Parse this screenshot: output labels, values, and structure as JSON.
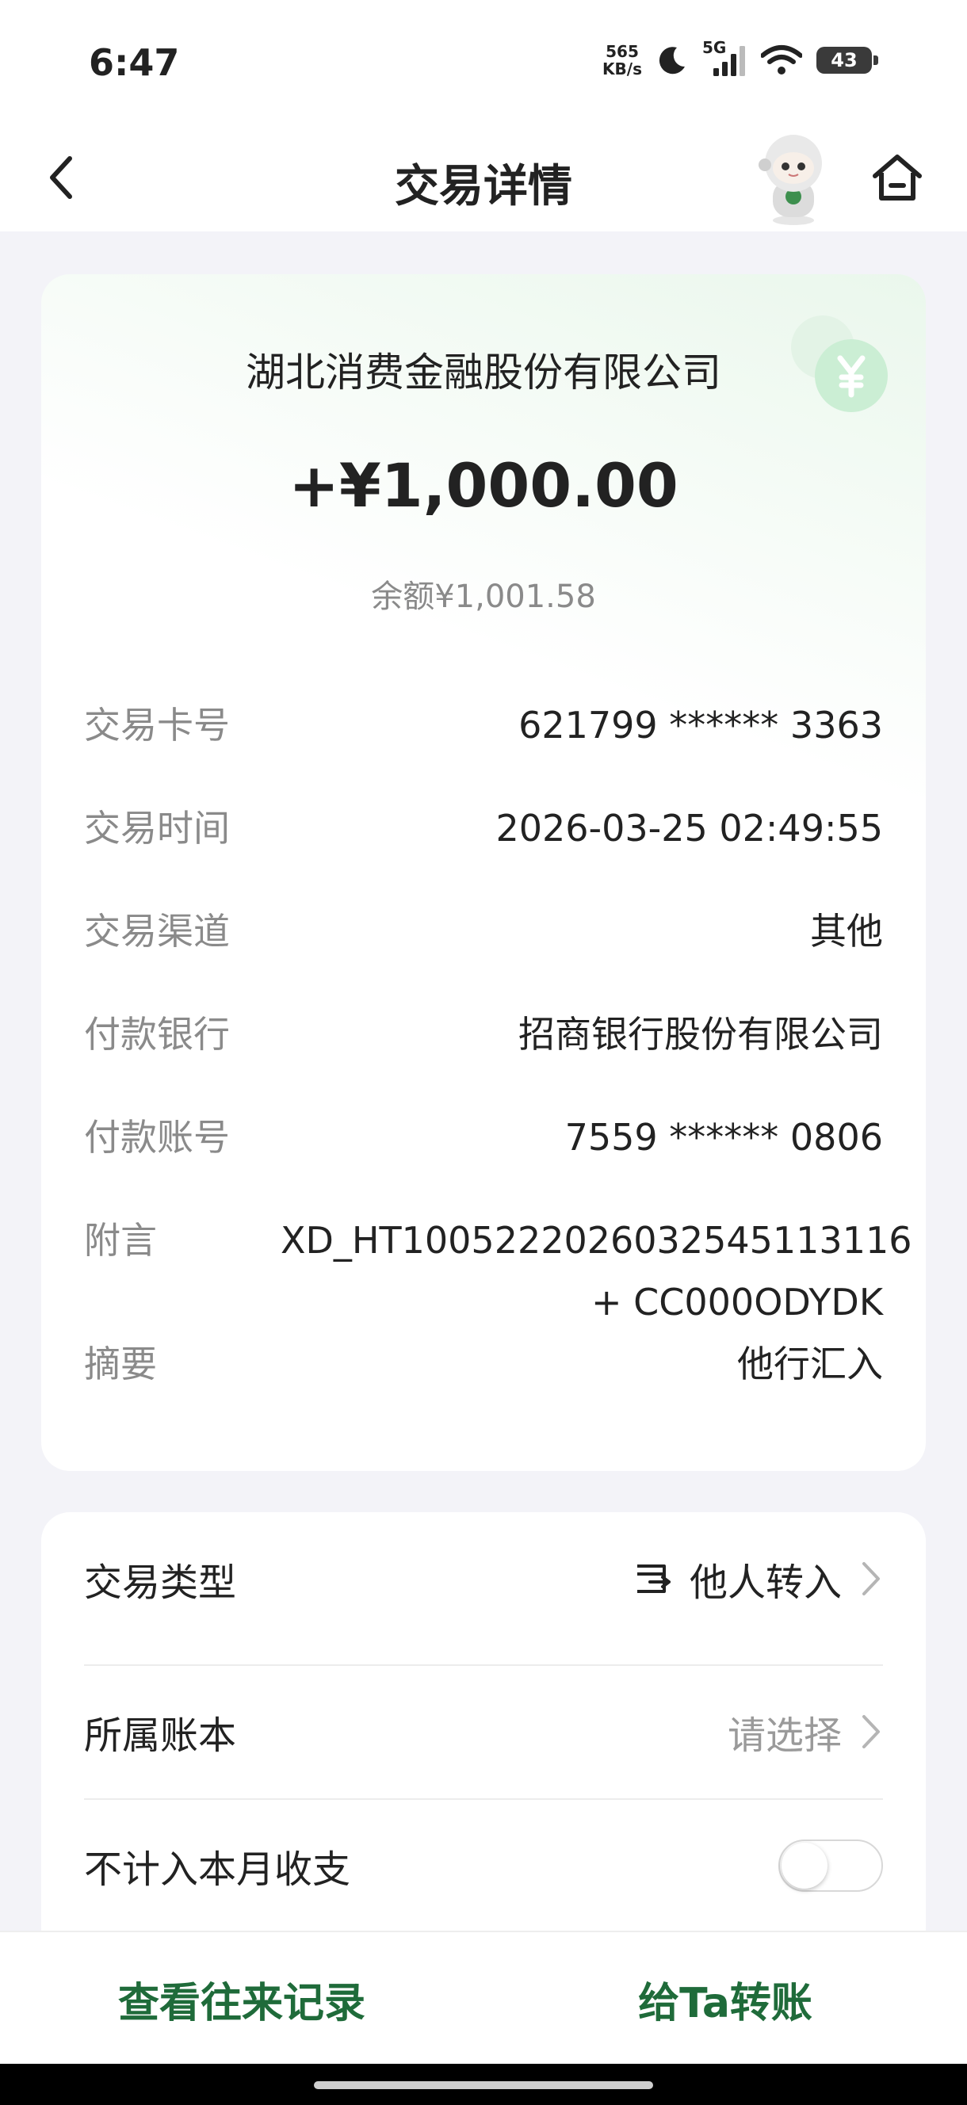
{
  "status_bar": {
    "time": "6:47",
    "net_speed_value": "565",
    "net_speed_unit": "KB/s",
    "network": "5G",
    "battery": "43"
  },
  "header": {
    "title": "交易详情",
    "back_icon": "chevron-left-icon",
    "home_icon": "home-icon"
  },
  "transaction": {
    "merchant": "湖北消费金融股份有限公司",
    "amount": "+¥1,000.00",
    "balance": "余额¥1,001.58",
    "details": [
      {
        "label": "交易卡号",
        "value": "621799 ****** 3363"
      },
      {
        "label": "交易时间",
        "value": "2026-03-25 02:49:55"
      },
      {
        "label": "交易渠道",
        "value": "其他"
      },
      {
        "label": "付款银行",
        "value": "招商银行股份有限公司"
      },
      {
        "label": "付款账号",
        "value": "7559 ****** 0806"
      },
      {
        "label": "附言",
        "value": "XD_HT10052220260325451131 16",
        "value_line2": "+ CC000ODYDK"
      },
      {
        "label": "摘要",
        "value": "他行汇入"
      }
    ]
  },
  "settings": {
    "type_label": "交易类型",
    "type_value": "他人转入",
    "ledger_label": "所属账本",
    "ledger_value": "请选择",
    "exclude_label": "不计入本月收支",
    "exclude_enabled": false
  },
  "bottom": {
    "history_label": "查看往来记录",
    "transfer_label": "给Ta转账"
  },
  "colors": {
    "accent_green": "#1f6b3a",
    "muted_text": "#8a8a8a"
  }
}
